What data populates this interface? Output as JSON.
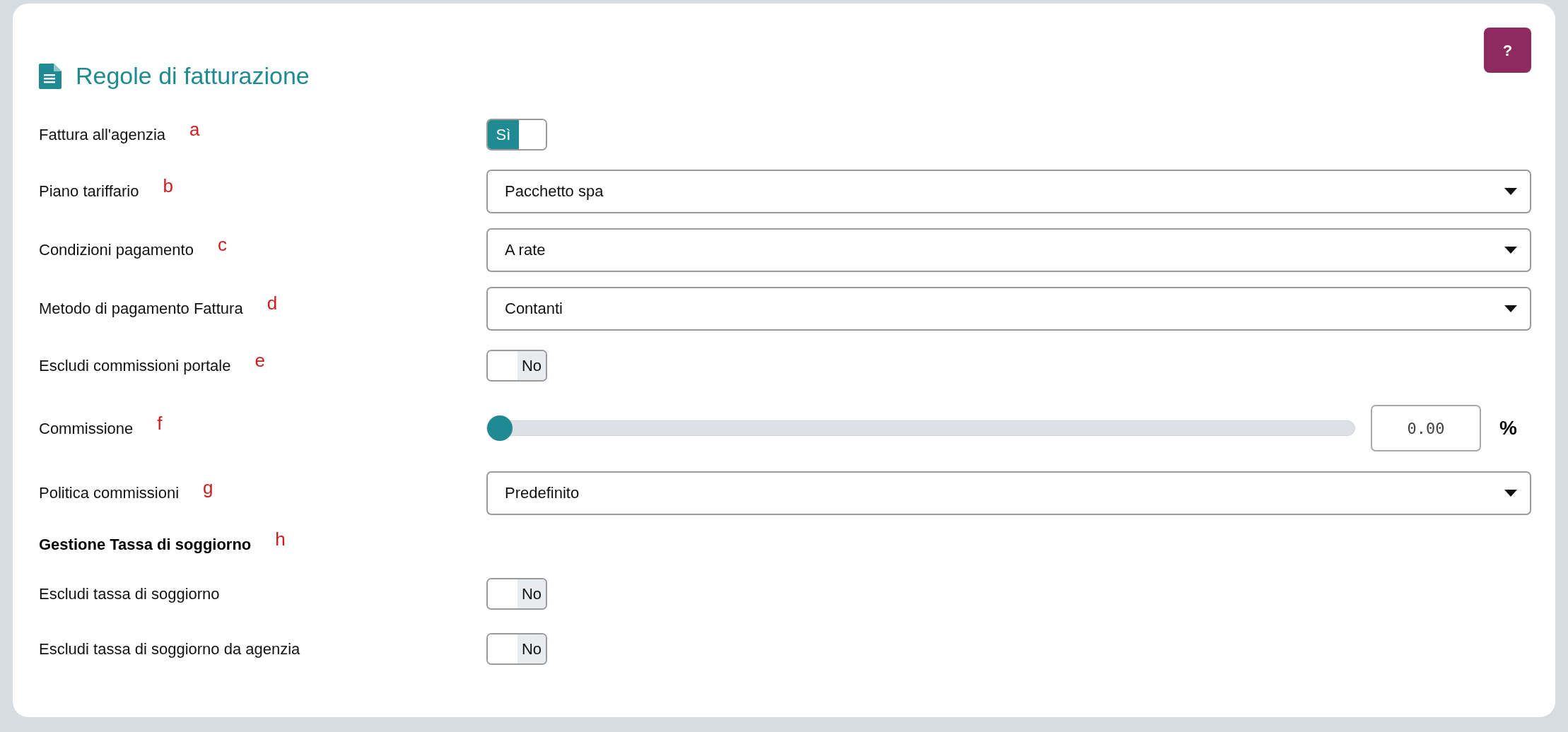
{
  "title": "Regole di fatturazione",
  "help_button": "?",
  "rows": [
    {
      "kind": "toggle",
      "label": "Fattura all'agenzia",
      "marker": "a",
      "on": true,
      "on_text": "Sì"
    },
    {
      "kind": "select",
      "label": "Piano tariffario",
      "marker": "b",
      "value": "Pacchetto spa"
    },
    {
      "kind": "select",
      "label": "Condizioni pagamento",
      "marker": "c",
      "value": "A rate"
    },
    {
      "kind": "select",
      "label": "Metodo di pagamento Fattura",
      "marker": "d",
      "value": "Contanti"
    },
    {
      "kind": "toggle",
      "label": "Escludi commissioni portale",
      "marker": "e",
      "on": false,
      "off_text": "No"
    },
    {
      "kind": "slider",
      "label": "Commissione",
      "marker": "f",
      "level": 0,
      "value": "0.00",
      "unit": "%"
    },
    {
      "kind": "select",
      "label": "Politica commissioni",
      "marker": "g",
      "value": "Predefinito"
    },
    {
      "kind": "heading",
      "label": "Gestione Tassa di soggiorno",
      "marker": "h"
    },
    {
      "kind": "toggle",
      "label": "Escludi tassa di soggiorno",
      "on": false,
      "off_text": "No"
    },
    {
      "kind": "toggle",
      "label": "Escludi tassa di soggiorno da agenzia",
      "on": false,
      "off_text": "No"
    }
  ]
}
